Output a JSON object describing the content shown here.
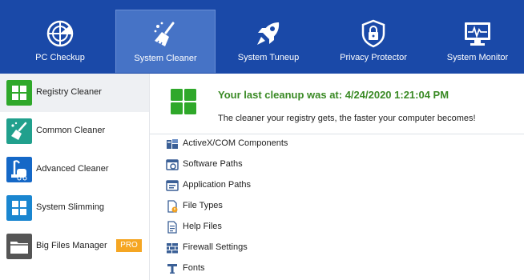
{
  "nav": {
    "tabs": [
      {
        "label": "PC Checkup",
        "icon": "pc-checkup-icon"
      },
      {
        "label": "System Cleaner",
        "icon": "broom-icon",
        "active": true
      },
      {
        "label": "System Tuneup",
        "icon": "rocket-icon"
      },
      {
        "label": "Privacy Protector",
        "icon": "lock-shield-icon"
      },
      {
        "label": "System Monitor",
        "icon": "monitor-icon"
      }
    ]
  },
  "sidebar": {
    "items": [
      {
        "label": "Registry Cleaner",
        "icon": "registry-grid-icon",
        "color": "#2fa82a",
        "active": true
      },
      {
        "label": "Common Cleaner",
        "icon": "brush-icon",
        "color": "#21a08d"
      },
      {
        "label": "Advanced Cleaner",
        "icon": "vacuum-icon",
        "color": "#1568c7"
      },
      {
        "label": "System Slimming",
        "icon": "windows-icon",
        "color": "#1a86d0"
      },
      {
        "label": "Big Files Manager",
        "icon": "folder-icon",
        "color": "#555555",
        "badge": "PRO"
      }
    ]
  },
  "main": {
    "title": "Your last cleanup was at: 4/24/2020 1:21:04 PM",
    "subtitle": "The cleaner your registry gets, the faster your computer becomes!",
    "categories": [
      {
        "label": "ActiveX/COM Components",
        "icon": "activex-icon"
      },
      {
        "label": "Software Paths",
        "icon": "software-paths-icon"
      },
      {
        "label": "Application Paths",
        "icon": "application-paths-icon"
      },
      {
        "label": "File Types",
        "icon": "file-types-icon"
      },
      {
        "label": "Help Files",
        "icon": "help-files-icon"
      },
      {
        "label": "Firewall Settings",
        "icon": "firewall-icon"
      },
      {
        "label": "Fonts",
        "icon": "fonts-icon"
      }
    ]
  },
  "colors": {
    "topbar": "#1a49a8",
    "active_tab": "#4673c6",
    "title_green": "#3a8a25",
    "pro_badge": "#f5a623"
  }
}
